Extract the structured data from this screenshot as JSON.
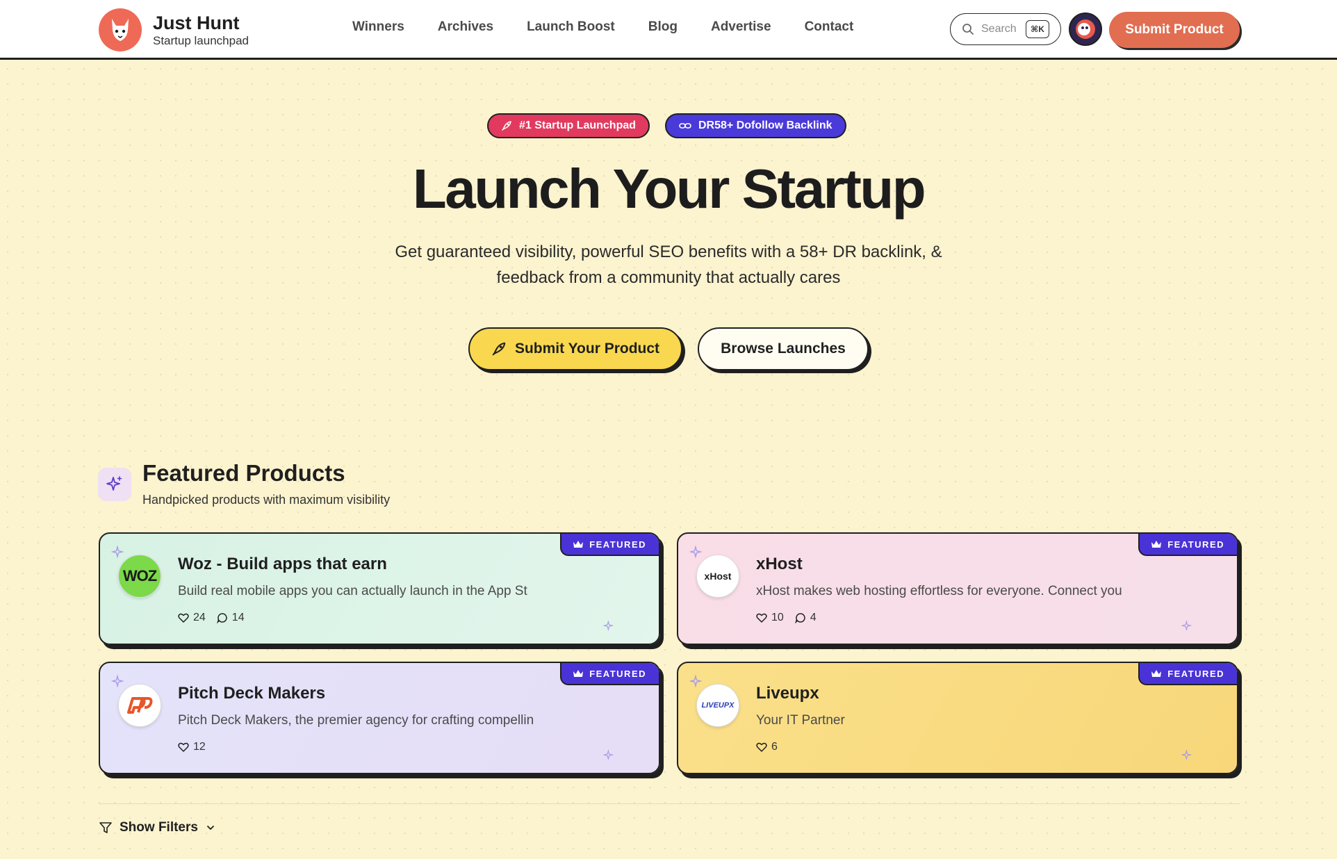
{
  "brand": {
    "name": "Just Hunt",
    "tagline": "Startup launchpad"
  },
  "nav": {
    "items": [
      "Winners",
      "Archives",
      "Launch Boost",
      "Blog",
      "Advertise",
      "Contact"
    ]
  },
  "search": {
    "placeholder": "Search",
    "shortcut": "⌘K"
  },
  "header": {
    "submit_label": "Submit Product"
  },
  "hero": {
    "pill_launchpad": "#1 Startup Launchpad",
    "pill_backlink": "DR58+ Dofollow Backlink",
    "title": "Launch Your Startup",
    "subtitle_line1": "Get guaranteed visibility, powerful SEO benefits with a 58+ DR backlink, &",
    "subtitle_line2": "feedback from a community that actually cares",
    "primary_cta": "Submit Your Product",
    "secondary_cta": "Browse Launches"
  },
  "featured": {
    "title": "Featured Products",
    "subtitle": "Handpicked products with maximum visibility",
    "badge_label": "FEATURED",
    "cards": [
      {
        "title": "Woz - Build apps that earn",
        "description": "Build real mobile apps you can actually launch in the App St",
        "likes": "24",
        "comments": "14",
        "logo_text": "woz",
        "logo_icon": "woz-logo"
      },
      {
        "title": "xHost",
        "description": "xHost makes web hosting effortless for everyone. Connect you",
        "likes": "10",
        "comments": "4",
        "logo_text": "xHost",
        "logo_icon": "xhost-logo"
      },
      {
        "title": "Pitch Deck Makers",
        "description": "Pitch Deck Makers, the premier agency for crafting compellin",
        "likes": "12",
        "logo_icon": "pitch-deck-logo"
      },
      {
        "title": "Liveupx",
        "description": "Your IT Partner",
        "likes": "6",
        "logo_text": "LIVEUPX",
        "logo_icon": "liveupx-logo"
      }
    ]
  },
  "filters": {
    "label": "Show Filters"
  },
  "colors": {
    "background": "#fcf3cf",
    "accent_orange": "#e16e51",
    "pill_pink": "#e23a5f",
    "pill_purple": "#4a3ad9",
    "cta_yellow": "#f9d84f",
    "badge_purple": "#4a33d6"
  }
}
